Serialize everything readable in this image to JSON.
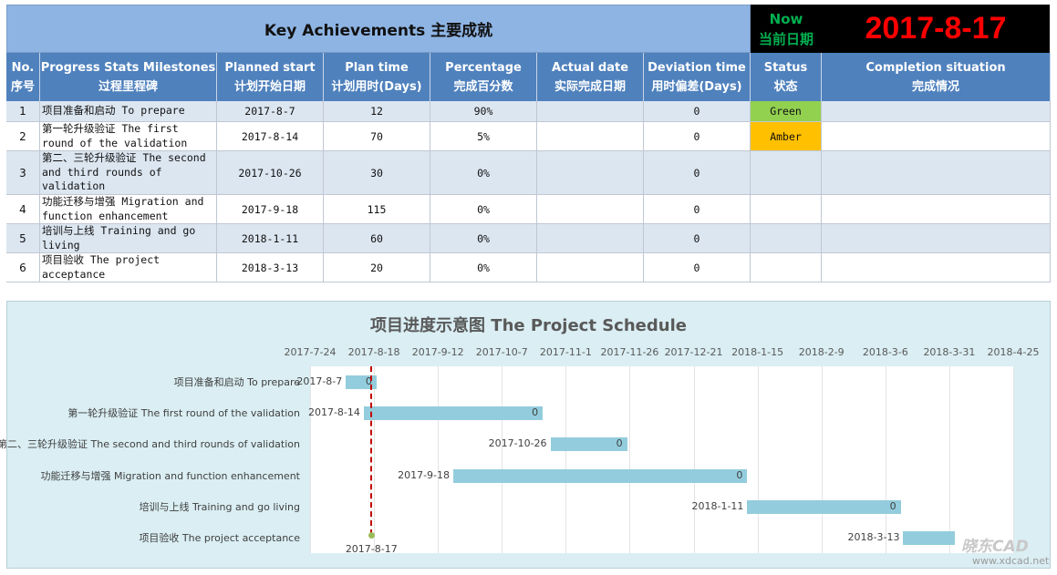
{
  "header": {
    "title": "Key Achievements 主要成就",
    "now_label_en": "Now",
    "now_label_cn": "当前日期",
    "current_date": "2017-8-17"
  },
  "columns": [
    {
      "en": "No.",
      "cn": "序号"
    },
    {
      "en": "Progress Stats Milestones",
      "cn": "过程里程碑"
    },
    {
      "en": "Planned start",
      "cn": "计划开始日期"
    },
    {
      "en": "Plan time",
      "cn": "计划用时(Days)"
    },
    {
      "en": "Percentage",
      "cn": "完成百分数"
    },
    {
      "en": "Actual date",
      "cn": "实际完成日期"
    },
    {
      "en": "Deviation time",
      "cn": "用时偏差(Days)"
    },
    {
      "en": "Status",
      "cn": "状态"
    },
    {
      "en": "Completion situation",
      "cn": "完成情况"
    }
  ],
  "rows": [
    {
      "no": "1",
      "milestone": "项目准备和启动 To prepare",
      "start": "2017-8-7",
      "plan": "12",
      "pct": "90%",
      "actual": "",
      "deviation": "0",
      "status": "Green",
      "status_color": "#92d050",
      "completion": ""
    },
    {
      "no": "2",
      "milestone": "第一轮升级验证 The first round of the validation",
      "start": "2017-8-14",
      "plan": "70",
      "pct": "5%",
      "actual": "",
      "deviation": "0",
      "status": "Amber",
      "status_color": "#ffc000",
      "completion": ""
    },
    {
      "no": "3",
      "milestone": "第二、三轮升级验证 The second and third rounds of validation",
      "start": "2017-10-26",
      "plan": "30",
      "pct": "0%",
      "actual": "",
      "deviation": "0",
      "status": "",
      "status_color": "",
      "completion": ""
    },
    {
      "no": "4",
      "milestone": "功能迁移与增强 Migration and function enhancement",
      "start": "2017-9-18",
      "plan": "115",
      "pct": "0%",
      "actual": "",
      "deviation": "0",
      "status": "",
      "status_color": "",
      "completion": ""
    },
    {
      "no": "5",
      "milestone": "培训与上线 Training and go living",
      "start": "2018-1-11",
      "plan": "60",
      "pct": "0%",
      "actual": "",
      "deviation": "0",
      "status": "",
      "status_color": "",
      "completion": ""
    },
    {
      "no": "6",
      "milestone": "项目验收 The project acceptance",
      "start": "2018-3-13",
      "plan": "20",
      "pct": "0%",
      "actual": "",
      "deviation": "0",
      "status": "",
      "status_color": "",
      "completion": ""
    }
  ],
  "chart_data": {
    "type": "bar",
    "title": "项目进度示意图 The Project Schedule",
    "x_ticks": [
      "2017-7-24",
      "2017-8-18",
      "2017-9-12",
      "2017-10-7",
      "2017-11-1",
      "2017-11-26",
      "2017-12-21",
      "2018-1-15",
      "2018-2-9",
      "2018-3-6",
      "2018-3-31",
      "2018-4-25"
    ],
    "xlim": [
      "2017-7-24",
      "2018-4-25"
    ],
    "categories": [
      "项目准备和启动 To prepare",
      "第一轮升级验证 The first round of the validation",
      "第二、三轮升级验证 The second and third rounds of validation",
      "功能迁移与增强 Migration and function enhancement",
      "培训与上线 Training and go living",
      "项目验收 The project acceptance"
    ],
    "starts": [
      "2017-8-7",
      "2017-8-14",
      "2017-10-26",
      "2017-9-18",
      "2018-1-11",
      "2018-3-13"
    ],
    "durations": [
      12,
      70,
      30,
      115,
      60,
      20
    ],
    "bar_labels": [
      "0",
      "0",
      "0",
      "0",
      "0",
      ""
    ],
    "current_date": "2017-8-17",
    "bar_color": "#93cddd",
    "now_line_color": "#c00000"
  },
  "watermark": {
    "text": "晓东CAD",
    "url": "www.xdcad.net"
  }
}
